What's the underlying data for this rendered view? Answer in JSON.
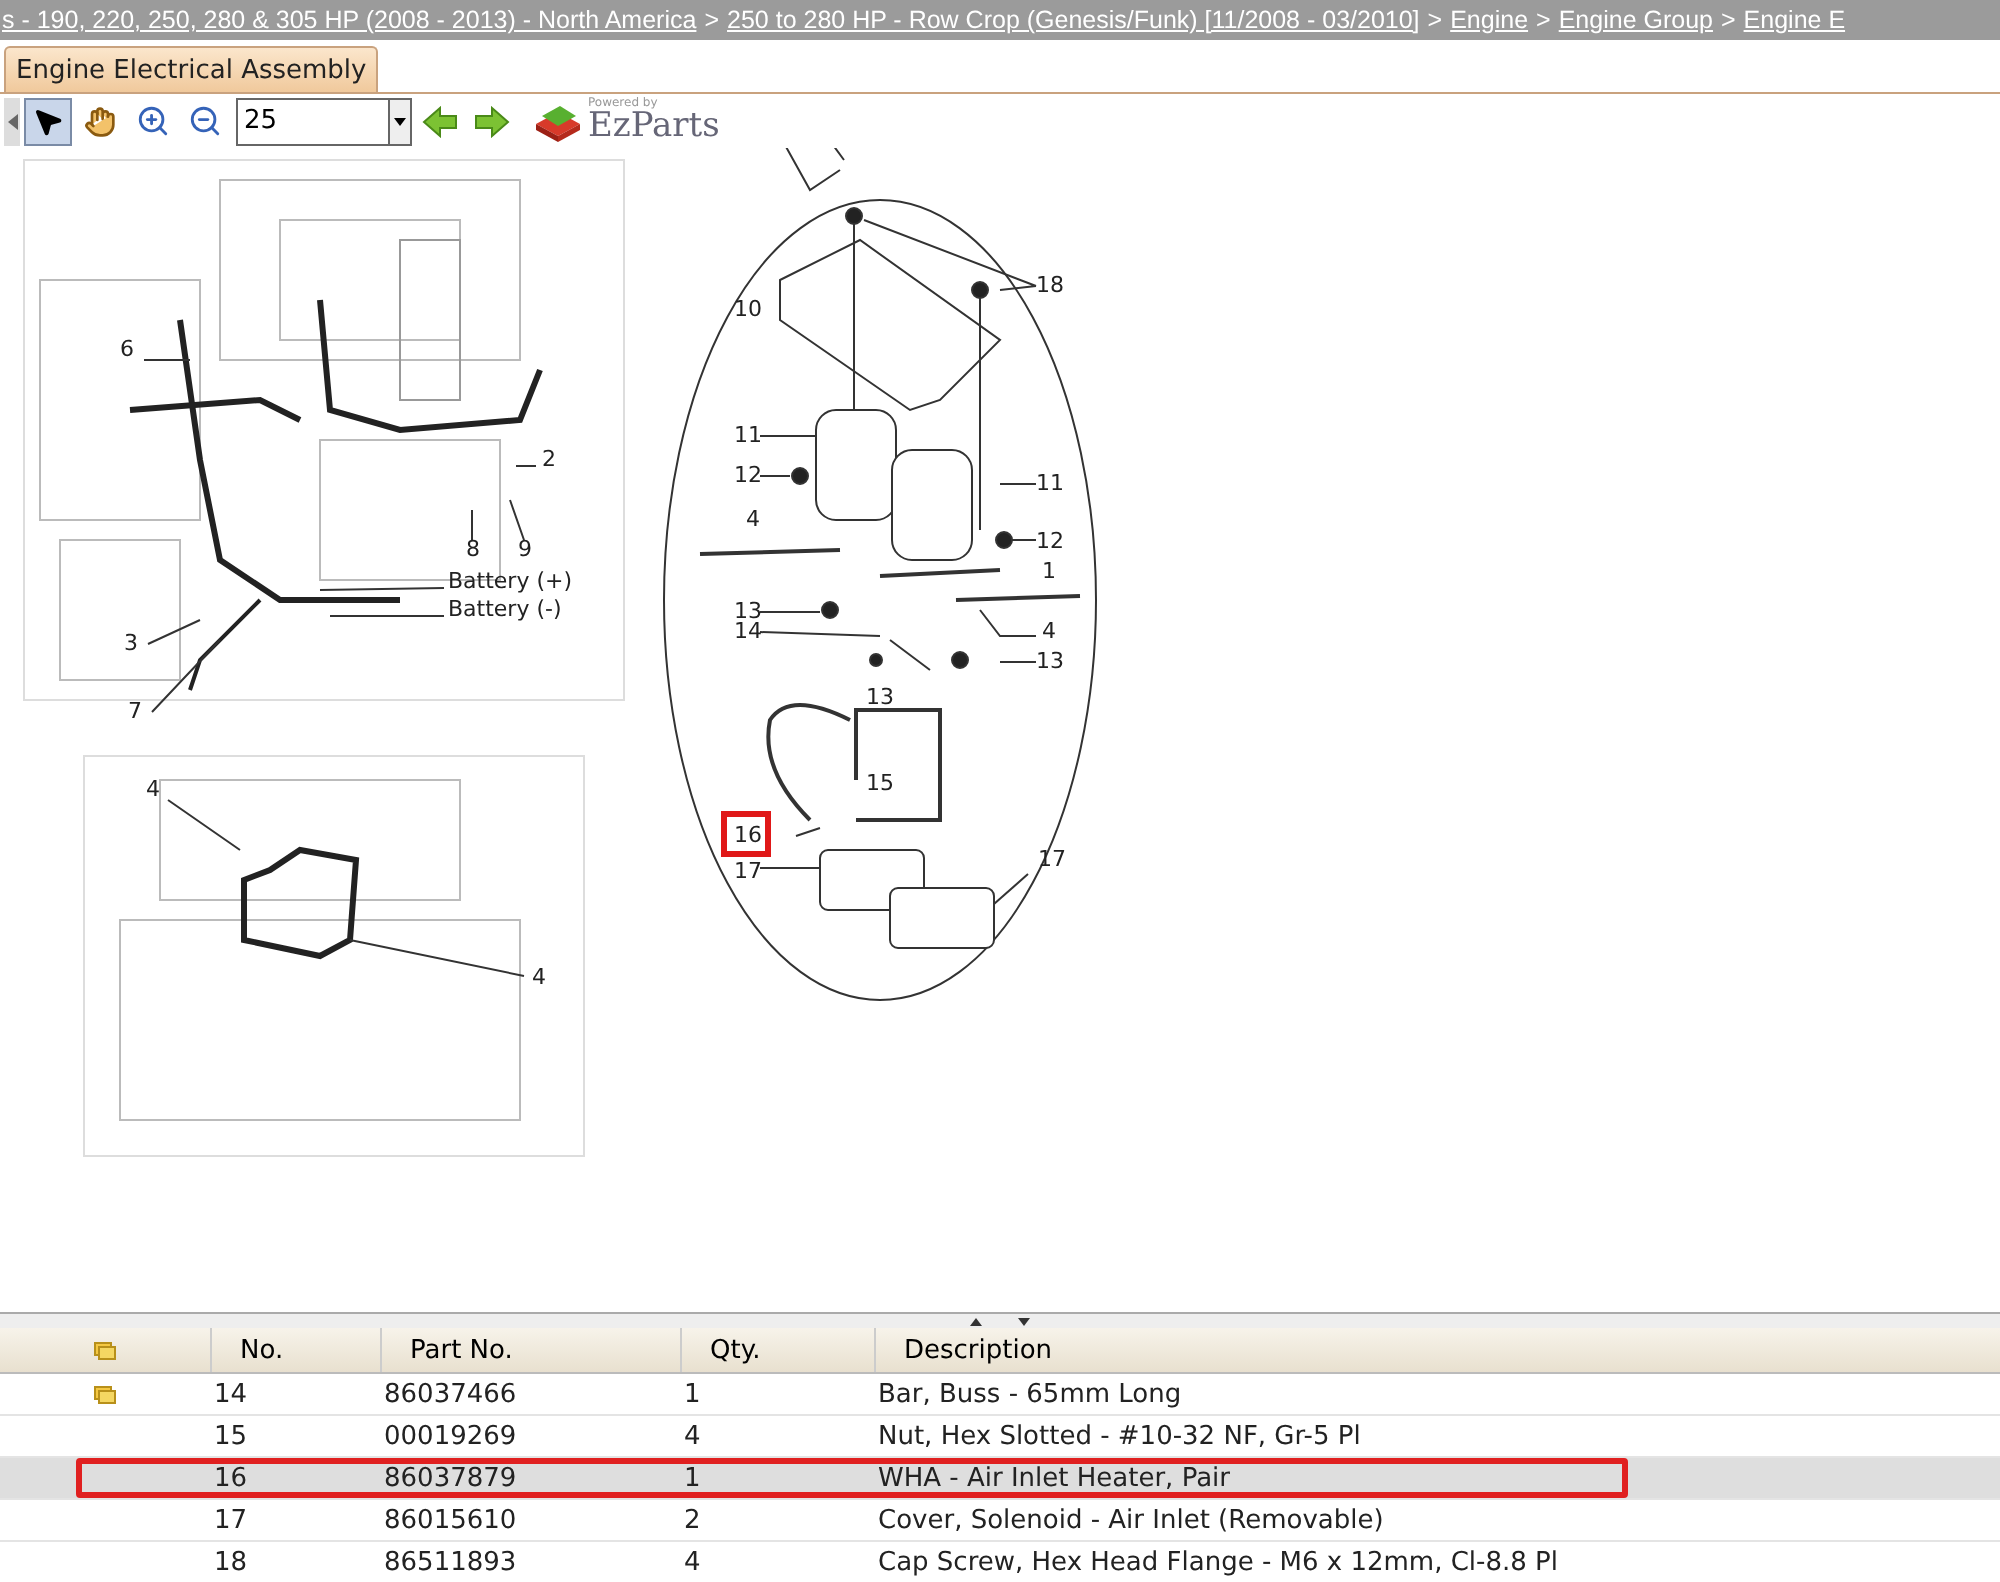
{
  "breadcrumb": [
    {
      "label": "s - 190, 220, 250, 280 & 305 HP (2008 - 2013) - North America"
    },
    {
      "label": "250 to 280 HP - Row Crop (Genesis/Funk) [11/2008 - 03/2010]"
    },
    {
      "label": "Engine"
    },
    {
      "label": "Engine Group"
    },
    {
      "label": "Engine E"
    }
  ],
  "separator": ">",
  "tabs": [
    {
      "label": "Engine Electrical Assembly",
      "selected": true
    }
  ],
  "toolbar": {
    "tools": [
      {
        "kind": "pointer",
        "selected": true
      },
      {
        "kind": "pan",
        "selected": false
      },
      {
        "kind": "zoom_in",
        "selected": false
      },
      {
        "kind": "zoom_out",
        "selected": false
      }
    ],
    "zoom": {
      "value": "25"
    },
    "nav": [
      {
        "kind": "back"
      },
      {
        "kind": "forward"
      }
    ],
    "logo": {
      "tagline": "Powered by",
      "name": "EzParts"
    }
  },
  "diagram": {
    "callouts": [
      {
        "label": "6",
        "highlighted": false
      },
      {
        "label": "2",
        "highlighted": false
      },
      {
        "label": "8",
        "highlighted": false
      },
      {
        "label": "9",
        "highlighted": false
      },
      {
        "label": "Battery (+)",
        "highlighted": false
      },
      {
        "label": "Battery (-)",
        "highlighted": false
      },
      {
        "label": "3",
        "highlighted": false
      },
      {
        "label": "7",
        "highlighted": false
      },
      {
        "label": "4",
        "highlighted": false
      },
      {
        "label": "4",
        "highlighted": false
      },
      {
        "label": "18",
        "highlighted": false
      },
      {
        "label": "10",
        "highlighted": false
      },
      {
        "label": "11",
        "highlighted": false
      },
      {
        "label": "12",
        "highlighted": false
      },
      {
        "label": "11",
        "highlighted": false
      },
      {
        "label": "12",
        "highlighted": false
      },
      {
        "label": "4",
        "highlighted": false
      },
      {
        "label": "1",
        "highlighted": false
      },
      {
        "label": "13",
        "highlighted": false
      },
      {
        "label": "14",
        "highlighted": false
      },
      {
        "label": "4",
        "highlighted": false
      },
      {
        "label": "13",
        "highlighted": false
      },
      {
        "label": "13",
        "highlighted": false
      },
      {
        "label": "15",
        "highlighted": false
      },
      {
        "label": "16",
        "highlighted": true
      },
      {
        "label": "17",
        "highlighted": false
      },
      {
        "label": "17",
        "highlighted": false
      }
    ]
  },
  "table": {
    "columns": [
      "No.",
      "Part No.",
      "Qty.",
      "Description"
    ],
    "rows": [
      {
        "note": true,
        "selected": false,
        "cells": [
          "14",
          "86037466",
          "1",
          "Bar, Buss - 65mm Long"
        ]
      },
      {
        "note": false,
        "selected": false,
        "cells": [
          "15",
          "00019269",
          "4",
          "Nut, Hex Slotted - #10-32 NF, Gr-5 Pl"
        ]
      },
      {
        "note": false,
        "selected": true,
        "cells": [
          "16",
          "86037879",
          "1",
          "WHA - Air Inlet Heater, Pair"
        ]
      },
      {
        "note": false,
        "selected": false,
        "cells": [
          "17",
          "86015610",
          "2",
          "Cover, Solenoid - Air Inlet (Removable)"
        ]
      },
      {
        "note": false,
        "selected": false,
        "cells": [
          "18",
          "86511893",
          "4",
          "Cap Screw, Hex Head Flange - M6 x 12mm, Cl-8.8 Pl"
        ]
      }
    ]
  }
}
